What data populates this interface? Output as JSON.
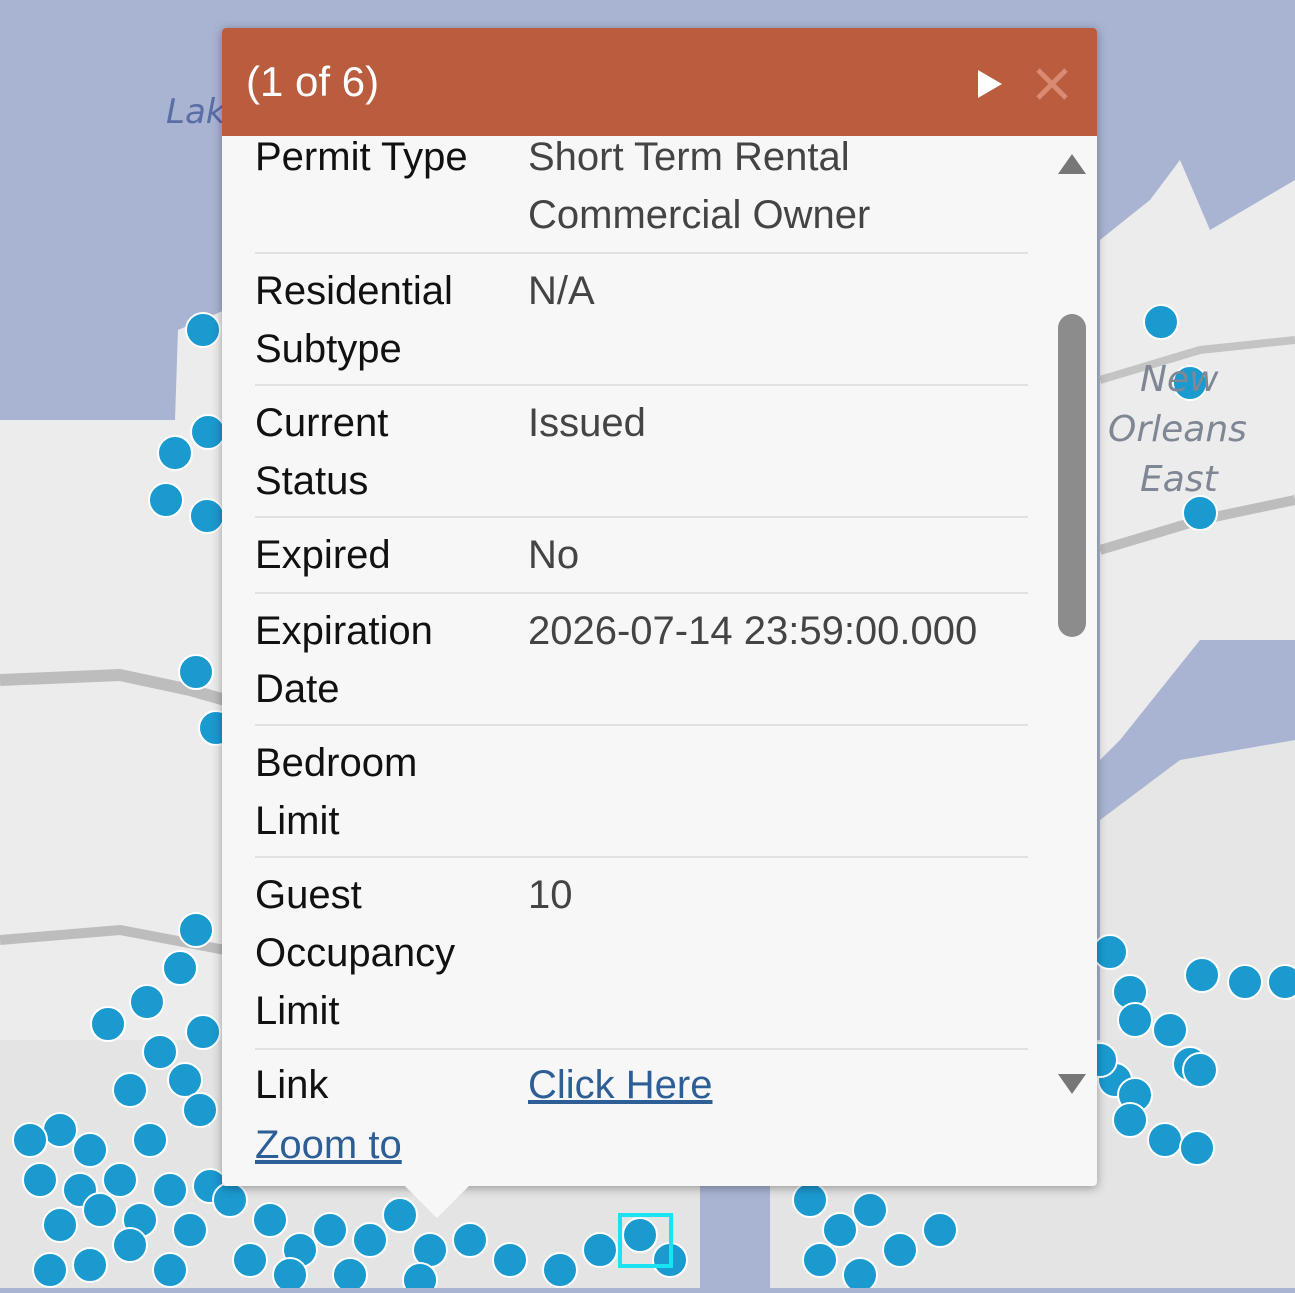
{
  "map": {
    "labels": {
      "lake": "Lak",
      "area_line1": "New",
      "area_line2": "Orleans",
      "area_line3": "East"
    },
    "colors": {
      "water": "#a9b4d2",
      "land": "#ececec",
      "point": "#1b9ad0",
      "point_stroke": "#ffffff",
      "road": "#c9c9c9",
      "selection": "#19e3f0"
    }
  },
  "popup": {
    "title": "(1 of 6)",
    "header_color": "#b95d3e",
    "next_icon": "play-triangle-icon",
    "close_icon": "close-x-icon",
    "fields": [
      {
        "label": "Permit Type",
        "value": "Short Term Rental Commercial Owner"
      },
      {
        "label": "Residential Subtype",
        "value": "N/A"
      },
      {
        "label": "Current Status",
        "value": "Issued"
      },
      {
        "label": "Expired",
        "value": "No"
      },
      {
        "label": "Expiration Date",
        "value": "2026-07-14 23:59:00.000"
      },
      {
        "label": "Bedroom Limit",
        "value": ""
      },
      {
        "label": "Guest Occupancy Limit",
        "value": "10"
      },
      {
        "label": "Link",
        "value": "Click Here"
      }
    ],
    "zoom_to": "Zoom to"
  }
}
